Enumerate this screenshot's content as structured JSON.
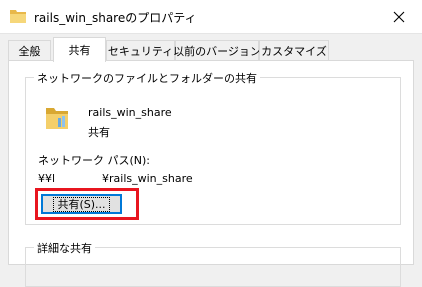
{
  "window": {
    "title": "rails_win_shareのプロパティ",
    "close_icon": "close-icon",
    "folder_icon": "folder-icon"
  },
  "tabs": [
    {
      "label": "全般",
      "active": false
    },
    {
      "label": "共有",
      "active": true
    },
    {
      "label": "セキュリティ",
      "active": false
    },
    {
      "label": "以前のバージョン",
      "active": false
    },
    {
      "label": "カスタマイズ",
      "active": false
    }
  ],
  "sharing_group": {
    "title": "ネットワークのファイルとフォルダーの共有",
    "folder_name": "rails_win_share",
    "status": "共有",
    "network_path_label": "ネットワーク パス(N):",
    "network_path_prefix": "¥¥l",
    "network_path_share": "¥rails_win_share",
    "share_button_label": "共有(S)..."
  },
  "advanced_group": {
    "title": "詳細な共有"
  },
  "colors": {
    "highlight": "#e8151f",
    "focus": "#0078d7",
    "folder": "#e8b84a"
  }
}
